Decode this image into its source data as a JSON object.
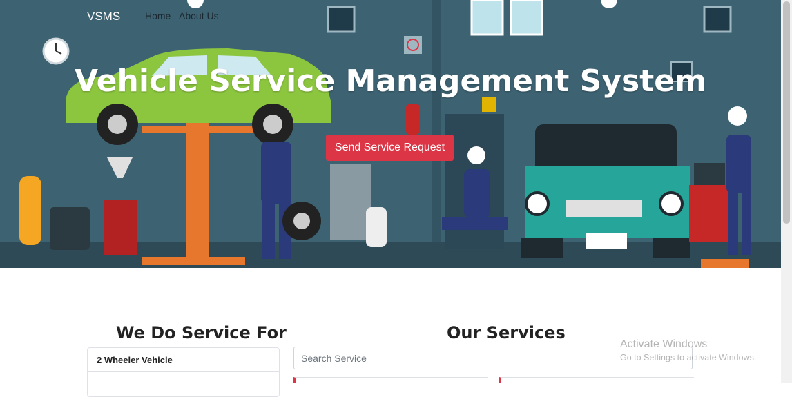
{
  "nav": {
    "brand": "VSMS",
    "links": [
      "Home",
      "About Us"
    ]
  },
  "hero": {
    "title": "Vehicle Service Management System",
    "cta_label": "Send Service Request"
  },
  "vehicle_types": {
    "title": "We Do Service For",
    "items": [
      "2 Wheeler Vehicle",
      ""
    ]
  },
  "services": {
    "title": "Our Services",
    "search_placeholder": "Search Service"
  },
  "watermark": {
    "line1": "Activate Windows",
    "line2": "Go to Settings to activate Windows."
  },
  "colors": {
    "hero_bg": "#3b6070",
    "accent": "#dc3545",
    "car_green": "#8cc63f",
    "car_teal": "#26a69a"
  }
}
